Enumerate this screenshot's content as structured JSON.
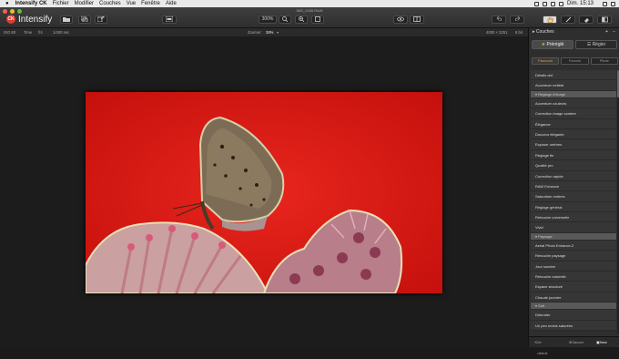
{
  "menubar": {
    "app": "Intensify CK",
    "items": [
      "Fichier",
      "Modifier",
      "Couches",
      "Vue",
      "Fenêtre",
      "Aide"
    ],
    "clock": "Dim. 15:13"
  },
  "window": {
    "title": "IMG_0436.RAW",
    "brand": "Intensify",
    "logo": "CK"
  },
  "toolbar": {
    "zoom": "300%"
  },
  "status": {
    "iso": "ISO 80",
    "time": "Time",
    "aperture": "f/4",
    "shutter": "1/400 sec",
    "zoom_label": "Zoomer:",
    "zoom_value": "28%",
    "dims": "4000 × 2251",
    "bits": "8 bit"
  },
  "panel": {
    "title": "Couches",
    "preset_btn": "Préréglé",
    "adjust_btn": "Régler",
    "tabs": [
      "Parcourir",
      "Favoris",
      "Pilote"
    ],
    "items": [
      {
        "label": "Détails ciel",
        "header": false
      },
      {
        "label": "Accentuer netteté",
        "header": false
      },
      {
        "label": "Réglage d'image",
        "header": true
      },
      {
        "label": "Accentuer couleurs",
        "header": false
      },
      {
        "label": "Correction image sombre",
        "header": false
      },
      {
        "label": "Élégance",
        "header": false
      },
      {
        "label": "Douceur élégante",
        "header": false
      },
      {
        "label": "Exposer ombres",
        "header": false
      },
      {
        "label": "Réglage fin",
        "header": false
      },
      {
        "label": "Qualité pro",
        "header": false
      },
      {
        "label": "Correction rapide",
        "header": false
      },
      {
        "label": "RAW Enhance",
        "header": false
      },
      {
        "label": "Saturation ombres",
        "header": false
      },
      {
        "label": "Réglage général",
        "header": false
      },
      {
        "label": "Retouche universelle",
        "header": false
      },
      {
        "label": "Vivid",
        "header": false
      },
      {
        "label": "Paysage",
        "header": true
      },
      {
        "label": "Aerial Photo Enhance-2",
        "header": false
      },
      {
        "label": "Retouche paysage",
        "header": false
      },
      {
        "label": "Jour sombre",
        "header": false
      },
      {
        "label": "Retouche naturelle",
        "header": false
      },
      {
        "label": "Espace structuré",
        "header": false
      },
      {
        "label": "Chaude journée",
        "header": false
      },
      {
        "label": "Soft",
        "header": true
      },
      {
        "label": "Débruiter",
        "header": false
      },
      {
        "label": "Un peu moins saturées",
        "header": false
      }
    ],
    "footer": {
      "reset": "Je détruit",
      "save": "Sauver",
      "new": "New"
    }
  }
}
